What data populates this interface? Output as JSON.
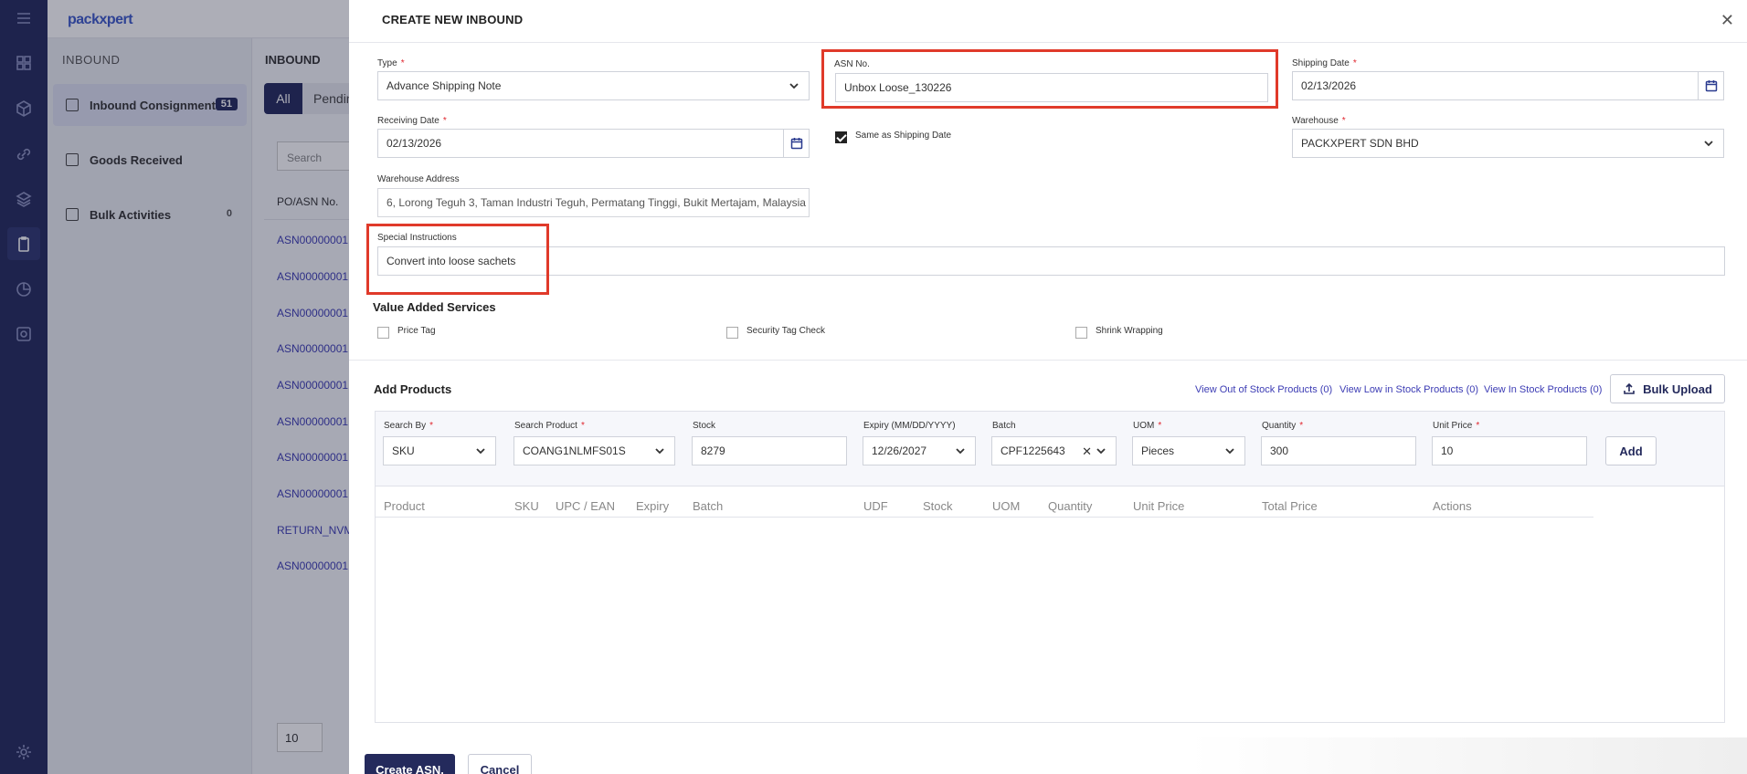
{
  "app": {
    "logo_text": "packxpert"
  },
  "leftnav": {
    "heading": "INBOUND",
    "items": [
      {
        "label": "Inbound Consignment",
        "badge": "51"
      },
      {
        "label": "Goods Received",
        "badge": ""
      },
      {
        "label": "Bulk Activities",
        "badge": "0"
      }
    ]
  },
  "listpanel": {
    "heading": "INBOUND",
    "tab_all": "All",
    "tab_pending": "Pendin",
    "search_placeholder": "Search",
    "column": "PO/ASN No.",
    "rows": [
      "ASN00000001",
      "ASN00000001",
      "ASN00000001",
      "ASN00000001",
      "ASN00000001",
      "ASN00000001",
      "ASN00000001",
      "ASN00000001",
      "RETURN_NVM",
      "ASN00000001"
    ],
    "page_size": "10"
  },
  "modal": {
    "title": "CREATE NEW INBOUND",
    "type": {
      "label": "Type",
      "value": "Advance Shipping Note"
    },
    "asn": {
      "label": "ASN No.",
      "value": "Unbox Loose_130226"
    },
    "shipping_date": {
      "label": "Shipping Date",
      "value": "02/13/2026"
    },
    "receiving_date": {
      "label": "Receiving Date",
      "value": "02/13/2026"
    },
    "same_as_shipping": {
      "label": "Same as Shipping Date",
      "checked": true
    },
    "warehouse": {
      "label": "Warehouse",
      "value": "PACKXPERT SDN BHD"
    },
    "warehouse_address": {
      "label": "Warehouse Address",
      "value": "6, Lorong Teguh 3, Taman Industri Teguh, Permatang Tinggi, Bukit Mertajam, Malaysia"
    },
    "special_instructions": {
      "label": "Special Instructions",
      "value": "Convert into loose sachets"
    },
    "vas": {
      "heading": "Value Added Services",
      "options": [
        "Price Tag",
        "Security Tag Check",
        "Shrink Wrapping"
      ]
    },
    "add_products": {
      "heading": "Add Products",
      "links": [
        "View Out of Stock Products (0)",
        "View Low in Stock Products (0)",
        "View In Stock Products (0)"
      ],
      "bulk_upload": "Bulk Upload",
      "form": {
        "search_by": {
          "label": "Search By",
          "value": "SKU"
        },
        "search_product": {
          "label": "Search Product",
          "value": "COANG1NLMFS01S"
        },
        "stock": {
          "label": "Stock",
          "value": "8279"
        },
        "expiry": {
          "label": "Expiry (MM/DD/YYYY)",
          "value": "12/26/2027"
        },
        "batch": {
          "label": "Batch",
          "value": "CPF1225643"
        },
        "uom": {
          "label": "UOM",
          "value": "Pieces"
        },
        "quantity": {
          "label": "Quantity",
          "value": "300"
        },
        "unit_price": {
          "label": "Unit Price",
          "value": "10"
        },
        "add_label": "Add"
      },
      "columns": [
        "Product",
        "SKU",
        "UPC / EAN",
        "Expiry",
        "Batch",
        "UDF",
        "Stock",
        "UOM",
        "Quantity",
        "Unit Price",
        "Total Price",
        "Actions"
      ]
    },
    "footer": {
      "create": "Create ASN.",
      "cancel": "Cancel"
    }
  },
  "colors": {
    "primary": "#242a5c",
    "link": "#3c3cb4",
    "highlight": "#e03a2a",
    "required": "#e0262e"
  }
}
